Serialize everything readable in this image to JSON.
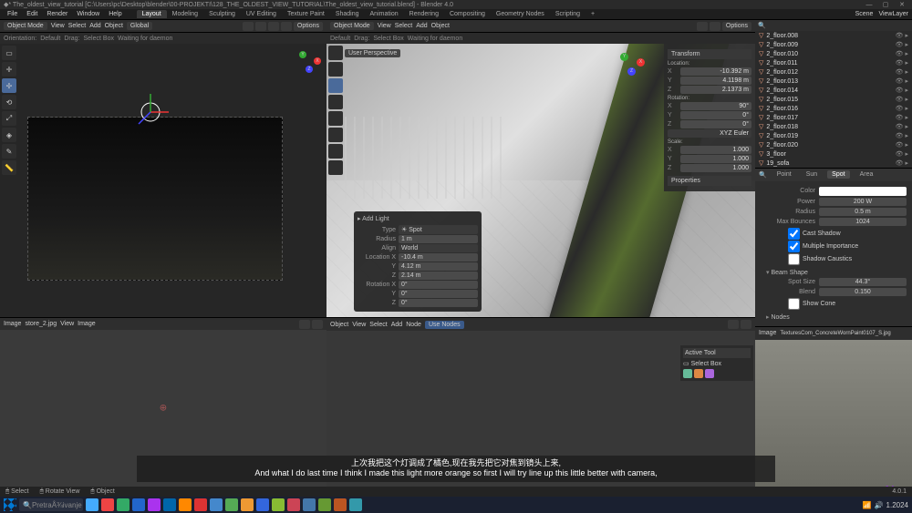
{
  "titlebar": {
    "title": "* The_oldest_view_tutorial [C:\\Users\\pc\\Desktop\\blender\\00-PROJEKTI\\128_THE_OLDEST_VIEW_TUTORIAL\\The_oldest_view_tutorial.blend] - Blender 4.0"
  },
  "menu": {
    "items": [
      "File",
      "Edit",
      "Render",
      "Window",
      "Help"
    ],
    "workspaces": [
      "Layout",
      "Modeling",
      "Sculpting",
      "UV Editing",
      "Texture Paint",
      "Shading",
      "Animation",
      "Rendering",
      "Compositing",
      "Geometry Nodes",
      "Scripting",
      "+"
    ],
    "active_ws": "Layout",
    "scene": "Scene",
    "viewlayer": "ViewLayer"
  },
  "vp_left": {
    "mode": "Object Mode",
    "menus": [
      "View",
      "Select",
      "Add",
      "Object"
    ],
    "global": "Global",
    "orientation": "Orientation:",
    "default": "Default",
    "drag": "Drag:",
    "select_box": "Select Box",
    "options": "Options",
    "waiting": "Waiting for daemon"
  },
  "vp_mid": {
    "persp": "User Perspective",
    "mode": "Object Mode",
    "menus": [
      "View",
      "Select",
      "Add",
      "Object"
    ],
    "default": "Default",
    "drag": "Drag:",
    "select_box": "Select Box",
    "options": "Options",
    "waiting": "Waiting for daemon"
  },
  "transform": {
    "title": "Transform",
    "loc_lbl": "Location:",
    "loc": {
      "x": "-10.392 m",
      "y": "4.1198 m",
      "z": "2.1373 m"
    },
    "rot_lbl": "Rotation:",
    "rot": {
      "x": "90°",
      "y": "0°",
      "z": "0°"
    },
    "rot_mode": "XYZ Euler",
    "scale_lbl": "Scale:",
    "scale": {
      "x": "1.000",
      "y": "1.000",
      "z": "1.000"
    },
    "properties_section": "Properties"
  },
  "popup": {
    "title": "Add Light",
    "type_lbl": "Type",
    "type": "Spot",
    "radius_lbl": "Radius",
    "radius": "1 m",
    "align_lbl": "Align",
    "align": "World",
    "locx_lbl": "Location X",
    "locx": "-10.4 m",
    "locy": "4.12 m",
    "locz": "2.14 m",
    "rotx_lbl": "Rotation X",
    "rotx": "0°",
    "roty": "0°",
    "rotz": "0°"
  },
  "active_tool": {
    "title": "Active Tool",
    "select_box": "Select Box"
  },
  "outliner": {
    "items": [
      "2_floor.008",
      "2_floor.009",
      "2_floor.010",
      "2_floor.011",
      "2_floor.012",
      "2_floor.013",
      "2_floor.014",
      "2_floor.015",
      "2_floor.016",
      "2_floor.017",
      "2_floor.018",
      "2_floor.019",
      "2_floor.020",
      "3_floor",
      "19_sofa"
    ]
  },
  "light_props": {
    "tabs": [
      "Point",
      "Sun",
      "Spot",
      "Area"
    ],
    "active_tab": "Spot",
    "color_lbl": "Color",
    "power_lbl": "Power",
    "power": "200 W",
    "radius_lbl": "Radius",
    "radius": "0.5 m",
    "bounces_lbl": "Max Bounces",
    "bounces": "1024",
    "cast_shadow": "Cast Shadow",
    "multiple_importance": "Multiple Importance",
    "shadow_caustics": "Shadow Caustics",
    "beam_title": "Beam Shape",
    "spot_size_lbl": "Spot Size",
    "spot_size": "44.3°",
    "blend_lbl": "Blend",
    "blend": "0.150",
    "show_cone": "Show Cone",
    "nodes_title": "Nodes"
  },
  "img_left": {
    "label": "Image",
    "file": "store_2.jpg",
    "menus": [
      "View",
      "Image"
    ]
  },
  "shader": {
    "label": "Object",
    "menus": [
      "View",
      "Select",
      "Add",
      "Node"
    ],
    "use_nodes": "Use Nodes"
  },
  "img_right": {
    "label": "Image",
    "file": "TexturesCom_ConcreteWornPaint0107_S.jpg"
  },
  "subtitle": {
    "cn": "上次我把这个灯调成了橘色,现在我先把它对焦到镜头上来,",
    "en": "And what I do last time I think I made this light more orange so first I will try line up this little better with camera,"
  },
  "status": {
    "select": "Select",
    "rotate": "Rotate View",
    "object": "Object",
    "version": "4.0.1"
  },
  "taskbar": {
    "search": "PretraÅ¾ivanje",
    "time": "1.2024"
  }
}
